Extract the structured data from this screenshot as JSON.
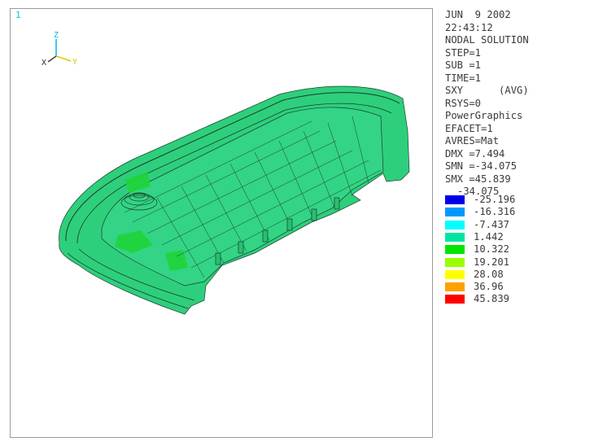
{
  "viewport": {
    "window_number": "1"
  },
  "triad": {
    "z_label": "Z",
    "x_label": "X",
    "y_label": "Y"
  },
  "info": {
    "lines": [
      "JUN  9 2002",
      "22:43:12",
      "NODAL SOLUTION",
      "STEP=1",
      "SUB =1",
      "TIME=1",
      "SXY      (AVG)",
      "RSYS=0",
      "PowerGraphics",
      "EFACET=1",
      "AVRES=Mat",
      "DMX =7.494",
      "SMN =-34.075",
      "SMX =45.839"
    ]
  },
  "legend": {
    "top_value": "-34.075",
    "entries": [
      {
        "color": "#0000e6",
        "label": "-25.196"
      },
      {
        "color": "#0099ff",
        "label": "-16.316"
      },
      {
        "color": "#00ffff",
        "label": "-7.437"
      },
      {
        "color": "#00e6a0",
        "label": "1.442"
      },
      {
        "color": "#00e600",
        "label": "10.322"
      },
      {
        "color": "#99ff00",
        "label": "19.201"
      },
      {
        "color": "#ffff00",
        "label": "28.08"
      },
      {
        "color": "#ffa000",
        "label": "36.96"
      },
      {
        "color": "#ff0000",
        "label": "45.839"
      }
    ]
  },
  "model": {
    "base_color": "#2ecf7c",
    "hot_color": "#1fd43a",
    "edge_color": "#1a3d2a"
  }
}
